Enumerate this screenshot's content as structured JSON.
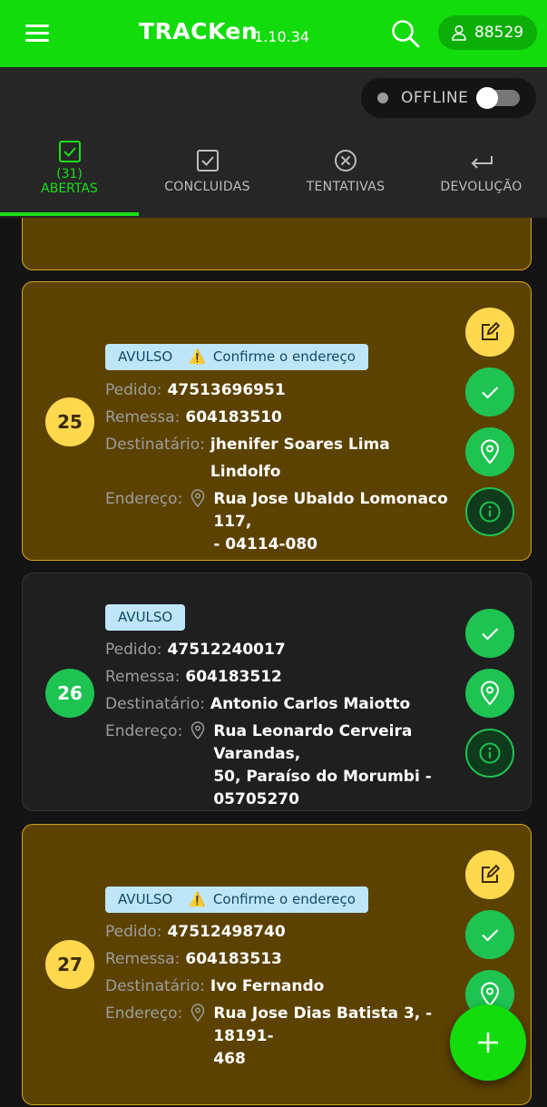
{
  "header": {
    "title": "TRACKen",
    "version": "1.10.34",
    "user_id": "88529"
  },
  "status": {
    "offline_label": "OFFLINE",
    "offline_enabled": false
  },
  "tabs": [
    {
      "count": "(31)",
      "label": "ABERTAS",
      "active": true,
      "icon": "checkbox-icon"
    },
    {
      "label": "CONCLUIDAS",
      "active": false,
      "icon": "checkbox-icon"
    },
    {
      "label": "TENTATIVAS",
      "active": false,
      "icon": "x-circle-icon"
    },
    {
      "label": "DEVOLUÇÃO",
      "active": false,
      "icon": "return-arrow-icon"
    }
  ],
  "labels": {
    "pedido": "Pedido:",
    "remessa": "Remessa:",
    "destinatario": "Destinatário:",
    "endereco": "Endereço:"
  },
  "colors": {
    "brand": "#12dc0c",
    "warning_card": "#5c4200",
    "success": "#1ec352",
    "yellow": "#ffd84e",
    "tag_bg": "#bfe6f8"
  },
  "deliveries": [
    {
      "number": "25",
      "tag": "AVULSO",
      "warning": "Confirme o endereço",
      "pedido": "47513696951",
      "remessa": "604183510",
      "destinatario": "jhenifer Soares Lima Lindolfo",
      "endereco_line1": "Rua Jose Ubaldo Lomonaco 117,",
      "endereco_line2": "- 04114-080"
    },
    {
      "number": "26",
      "tag": "AVULSO",
      "pedido": "47512240017",
      "remessa": "604183512",
      "destinatario": "Antonio Carlos Maiotto",
      "endereco_line1": "Rua Leonardo Cerveira Varandas,",
      "endereco_line2": "50, Paraíso do Morumbi -",
      "endereco_line3": "05705270"
    },
    {
      "number": "27",
      "tag": "AVULSO",
      "warning": "Confirme o endereço",
      "pedido": "47512498740",
      "remessa": "604183513",
      "destinatario": "Ivo Fernando",
      "endereco_line1": "Rua Jose Dias Batista 3, - 18191-",
      "endereco_line2": "468"
    }
  ]
}
